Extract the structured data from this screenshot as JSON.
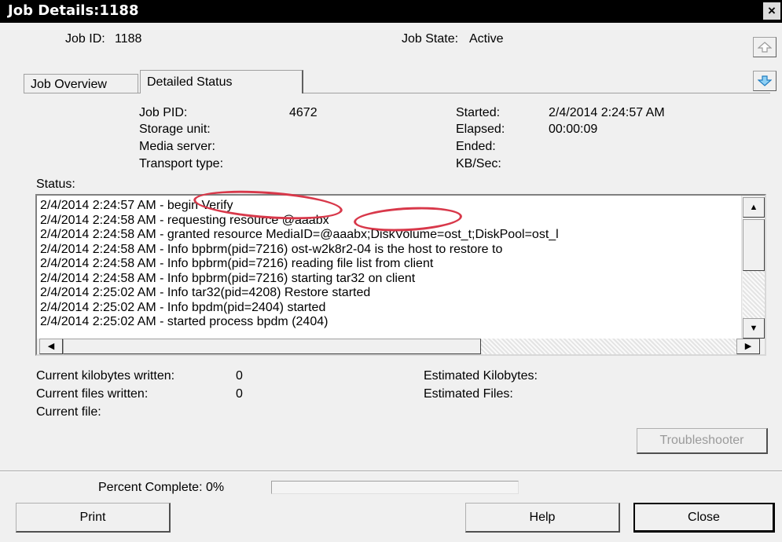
{
  "window": {
    "title": "Job Details:1188",
    "close_glyph": "×"
  },
  "header": {
    "job_id_label": "Job ID:",
    "job_id_value": "1188",
    "job_state_label": "Job State:",
    "job_state_value": "Active"
  },
  "nav": {
    "up_icon": "arrow-up-icon",
    "down_icon": "arrow-down-icon"
  },
  "tabs": [
    {
      "label": "Job Overview",
      "active": false
    },
    {
      "label": "Detailed Status",
      "active": true
    }
  ],
  "details": {
    "job_pid_label": "Job PID:",
    "job_pid_value": "4672",
    "storage_unit_label": "Storage unit:",
    "storage_unit_value": "",
    "media_server_label": "Media server:",
    "media_server_value": "",
    "transport_type_label": "Transport type:",
    "transport_type_value": "",
    "started_label": "Started:",
    "started_value": "2/4/2014 2:24:57 AM",
    "elapsed_label": "Elapsed:",
    "elapsed_value": "00:00:09",
    "ended_label": "Ended:",
    "ended_value": "",
    "kbsec_label": "KB/Sec:",
    "kbsec_value": ""
  },
  "status": {
    "label": "Status:",
    "lines": [
      "2/4/2014 2:24:57 AM - begin Verify",
      "2/4/2014 2:24:58 AM - requesting resource @aaabx",
      "2/4/2014 2:24:58 AM - granted resource MediaID=@aaabx;DiskVolume=ost_t;DiskPool=ost_l",
      "2/4/2014 2:24:58 AM - Info bpbrm(pid=7216) ost-w2k8r2-04 is the host to restore to",
      "2/4/2014 2:24:58 AM - Info bpbrm(pid=7216) reading file list from client",
      "2/4/2014 2:24:58 AM - Info bpbrm(pid=7216) starting tar32 on client",
      "2/4/2014 2:25:02 AM - Info tar32(pid=4208) Restore started",
      "2/4/2014 2:25:02 AM - Info bpdm(pid=2404) started",
      "2/4/2014 2:25:02 AM - started process bpdm (2404)"
    ]
  },
  "stats": {
    "kb_written_label": "Current kilobytes written:",
    "kb_written_value": "0",
    "files_written_label": "Current files written:",
    "files_written_value": "0",
    "current_file_label": "Current file:",
    "current_file_value": "",
    "est_kb_label": "Estimated Kilobytes:",
    "est_kb_value": "",
    "est_files_label": "Estimated Files:",
    "est_files_value": ""
  },
  "buttons": {
    "troubleshooter": "Troubleshooter",
    "print": "Print",
    "help": "Help",
    "close": "Close"
  },
  "progress": {
    "label": "Percent Complete: 0%",
    "percent": 0
  },
  "annotation_color": "#d8384a"
}
